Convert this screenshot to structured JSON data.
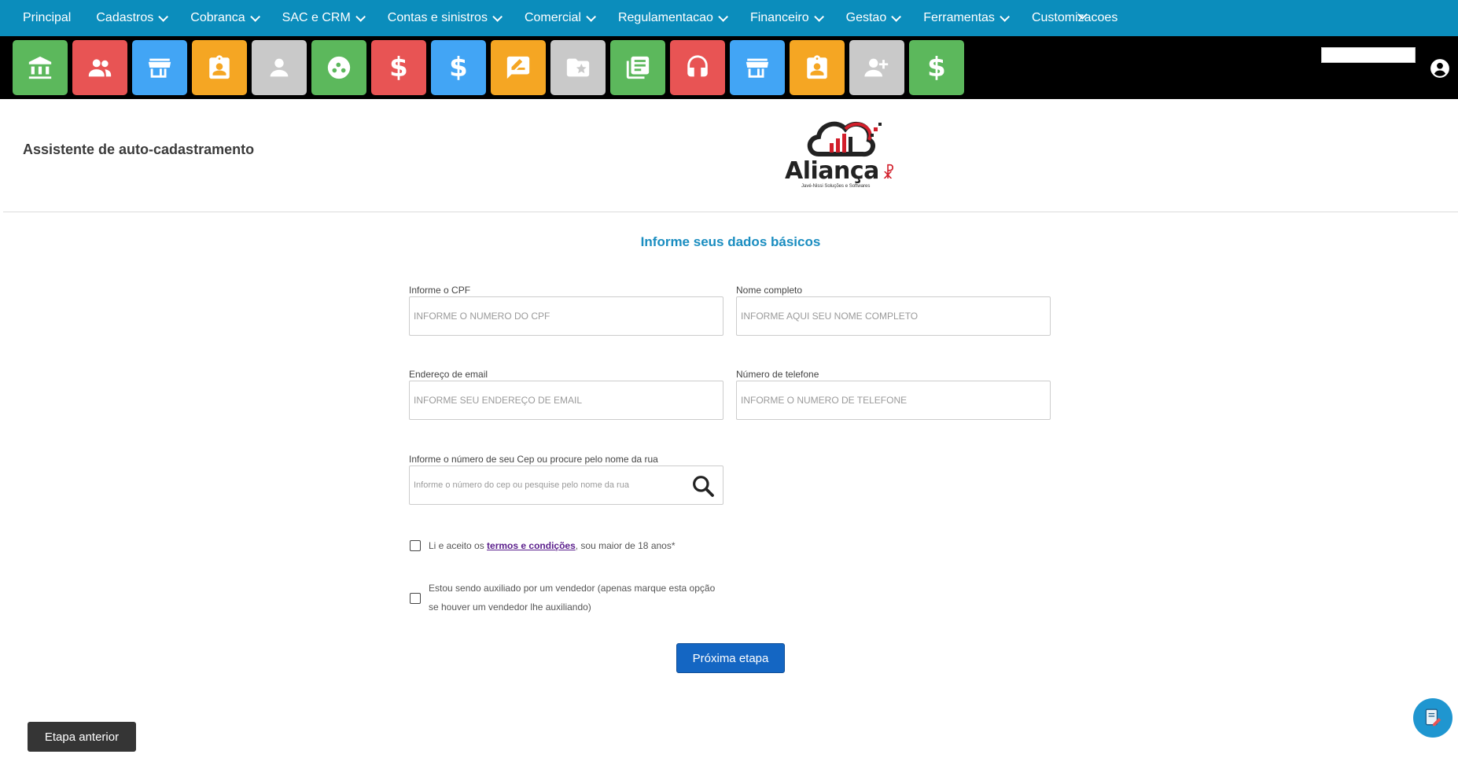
{
  "nav": {
    "items": [
      {
        "label": "Principal",
        "has_dropdown": false
      },
      {
        "label": "Cadastros",
        "has_dropdown": true
      },
      {
        "label": "Cobranca",
        "has_dropdown": true
      },
      {
        "label": "SAC e CRM",
        "has_dropdown": true
      },
      {
        "label": "Contas e sinistros",
        "has_dropdown": true
      },
      {
        "label": "Comercial",
        "has_dropdown": true
      },
      {
        "label": "Regulamentacao",
        "has_dropdown": true
      },
      {
        "label": "Financeiro",
        "has_dropdown": true
      },
      {
        "label": "Gestao",
        "has_dropdown": true
      },
      {
        "label": "Ferramentas",
        "has_dropdown": true
      },
      {
        "label": "Customizacoes",
        "has_dropdown": false
      }
    ],
    "background": "#0b8dbc"
  },
  "toolbar": {
    "tiles": [
      {
        "icon": "bank-icon",
        "color": "#5cb85c"
      },
      {
        "icon": "people-icon",
        "color": "#e85454"
      },
      {
        "icon": "store-icon",
        "color": "#42a5f5"
      },
      {
        "icon": "contact-badge-icon",
        "color": "#f5a623"
      },
      {
        "icon": "person-icon",
        "color": "#c9c9c9"
      },
      {
        "icon": "dots-circle-icon",
        "color": "#5cb85c"
      },
      {
        "icon": "dollar-icon",
        "color": "#e85454"
      },
      {
        "icon": "dollar-icon",
        "color": "#42a5f5"
      },
      {
        "icon": "edit-note-icon",
        "color": "#f5a623"
      },
      {
        "icon": "folder-star-icon",
        "color": "#c9c9c9"
      },
      {
        "icon": "newspaper-icon",
        "color": "#5cb85c"
      },
      {
        "icon": "headset-icon",
        "color": "#e85454"
      },
      {
        "icon": "store-icon",
        "color": "#42a5f5"
      },
      {
        "icon": "contact-badge-icon",
        "color": "#f5a623"
      },
      {
        "icon": "add-person-icon",
        "color": "#c9c9c9"
      },
      {
        "icon": "dollar-icon",
        "color": "#5cb85c"
      }
    ]
  },
  "header": {
    "title": "Assistente de auto-cadastramento",
    "logo_text": "Aliança",
    "logo_subtext": "Javé-Nissi Soluções e Softwares"
  },
  "form": {
    "title": "Informe seus dados básicos",
    "cpf": {
      "label": "Informe o CPF",
      "placeholder": "INFORME O NUMERO DO CPF",
      "value": ""
    },
    "name": {
      "label": "Nome completo",
      "placeholder": "INFORME AQUI SEU NOME COMPLETO",
      "value": ""
    },
    "email": {
      "label": "Endereço de email",
      "placeholder": "INFORME SEU ENDEREÇO DE EMAIL",
      "value": ""
    },
    "phone": {
      "label": "Número de telefone",
      "placeholder": "INFORME O NUMERO DE TELEFONE",
      "value": ""
    },
    "cep": {
      "label": "Informe o número de seu Cep ou procure pelo nome da rua",
      "placeholder": "Informe o número do cep ou pesquise pelo nome da rua",
      "value": ""
    },
    "terms": {
      "prefix": "Li e aceito os ",
      "link": "termos e condições",
      "suffix": ", sou maior de 18 anos*",
      "checked": false
    },
    "seller": {
      "line1": "Estou sendo auxiliado por um vendedor (apenas marque esta opção",
      "line2": "se houver um vendedor lhe auxiliando)",
      "checked": false
    },
    "next_label": "Próxima etapa"
  },
  "footer": {
    "prev_label": "Etapa anterior"
  }
}
